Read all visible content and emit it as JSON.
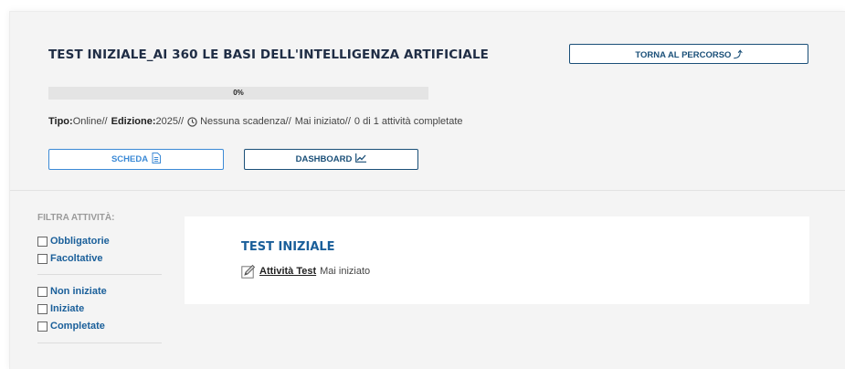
{
  "header": {
    "title": "TEST INIZIALE_AI 360 LE BASI DELL'INTELLIGENZA ARTIFICIALE",
    "back_button": "TORNA AL PERCORSO ⤴"
  },
  "progress": {
    "label": "0%",
    "value": 0
  },
  "meta": {
    "tipo_label": "Tipo:",
    "tipo_value": "Online//",
    "edizione_label": "Edizione:",
    "edizione_value": "2025//",
    "scadenza": "Nessuna scadenza//",
    "stato": "Mai iniziato//",
    "completate": "0 di 1 attività completate"
  },
  "buttons": {
    "scheda": "SCHEDA",
    "dashboard": "DASHBOARD"
  },
  "filters": {
    "title": "FILTRA ATTIVITÀ:",
    "group1": [
      "Obbligatorie",
      "Facoltative"
    ],
    "group2": [
      "Non iniziate",
      "Iniziate",
      "Completate"
    ]
  },
  "card": {
    "title": "TEST INIZIALE",
    "activity_link": "Attività Test",
    "activity_status": "Mai iniziato"
  },
  "colors": {
    "primary": "#1a4f78",
    "accent": "#3c8ad6",
    "link": "#1a5f9a"
  },
  "icons": [
    "document-icon",
    "chart-icon",
    "clock-icon",
    "edit-icon",
    "share-icon"
  ]
}
